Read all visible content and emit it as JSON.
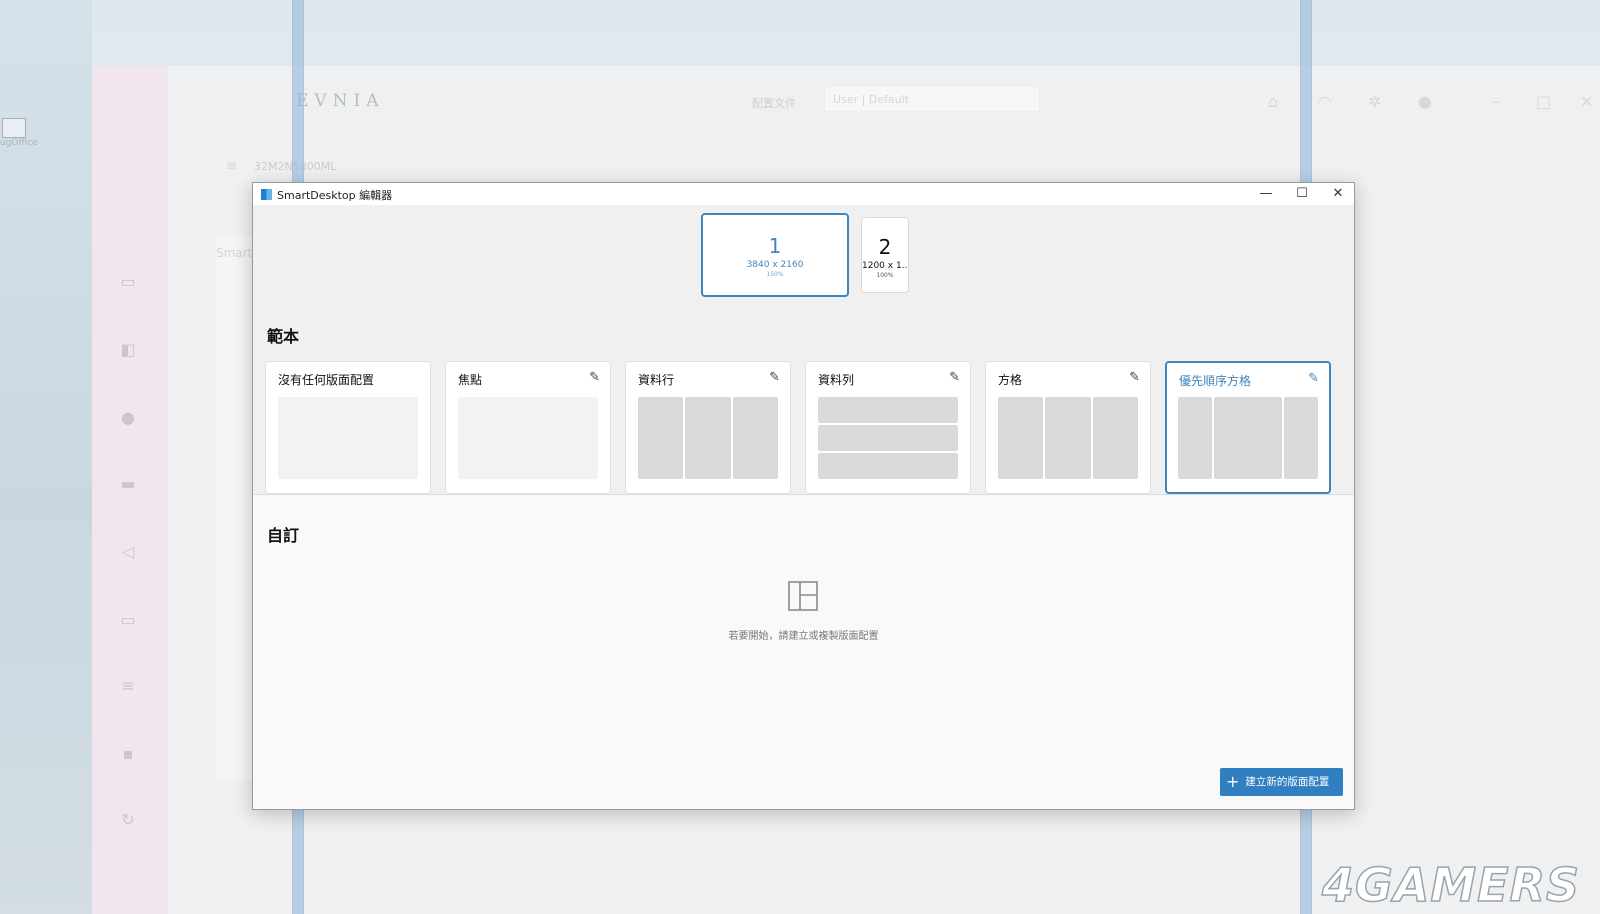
{
  "background": {
    "desktop_icon_label": "ugOffice",
    "evnia": {
      "logo": "EVNIA",
      "profile_label": "配置文件",
      "profile_value": "User | Default",
      "crumb": "32M2N5800ML",
      "panel_title": "Smart"
    },
    "watermark": "4GAMERS"
  },
  "window": {
    "title": "SmartDesktop 編輯器",
    "minimize_glyph": "—",
    "maximize_glyph": "☐",
    "close_glyph": "✕"
  },
  "monitors": [
    {
      "number": "1",
      "resolution": "3840 x 2160",
      "scale": "150%"
    },
    {
      "number": "2",
      "resolution": "1200 x 1...",
      "scale": "100%"
    }
  ],
  "templates": {
    "title": "範本",
    "cards": [
      {
        "label": "沒有任何版面配置",
        "layout": "none"
      },
      {
        "label": "焦點",
        "layout": "focus"
      },
      {
        "label": "資料行",
        "layout": "columns"
      },
      {
        "label": "資料列",
        "layout": "rows"
      },
      {
        "label": "方格",
        "layout": "grid"
      },
      {
        "label": "優先順序方格",
        "layout": "priority-grid",
        "selected": true
      }
    ]
  },
  "custom": {
    "title": "自訂",
    "empty_message": "若要開始，請建立或複製版面配置",
    "create_button": "建立新的版面配置"
  },
  "colors": {
    "accent": "#3f86bf",
    "button": "#2f7fc1"
  }
}
